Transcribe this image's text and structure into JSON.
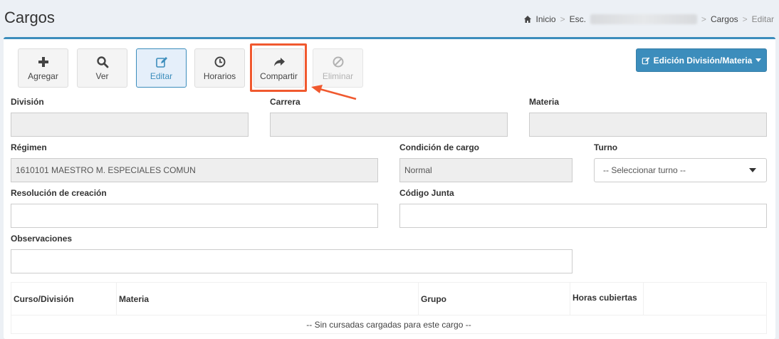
{
  "header": {
    "title": "Cargos"
  },
  "breadcrumb": {
    "home": "Inicio",
    "school_prefix": "Esc.",
    "current_section": "Cargos",
    "current": "Editar"
  },
  "toolbar": {
    "add": "Agregar",
    "view": "Ver",
    "edit": "Editar",
    "schedule": "Horarios",
    "share": "Compartir",
    "delete": "Eliminar",
    "dropdown": "Edición División/Materia"
  },
  "form": {
    "division_label": "División",
    "division_value": "",
    "career_label": "Carrera",
    "career_value": "",
    "subject_label": "Materia",
    "subject_value": "",
    "regime_label": "Régimen",
    "regime_value": "1610101 MAESTRO M. ESPECIALES COMUN",
    "condition_label": "Condición de cargo",
    "condition_value": "Normal",
    "shift_label": "Turno",
    "shift_value": "-- Seleccionar turno --",
    "resolution_label": "Resolución de creación",
    "resolution_value": "",
    "board_code_label": "Código Junta",
    "board_code_value": "",
    "observations_label": "Observaciones",
    "observations_value": ""
  },
  "table": {
    "columns": [
      "Curso/División",
      "Materia",
      "Grupo",
      "Horas cubiertas",
      ""
    ],
    "empty_message": "-- Sin cursadas cargadas para este cargo --"
  },
  "colors": {
    "accent": "#3c8dbc",
    "highlight": "#f0592f"
  }
}
